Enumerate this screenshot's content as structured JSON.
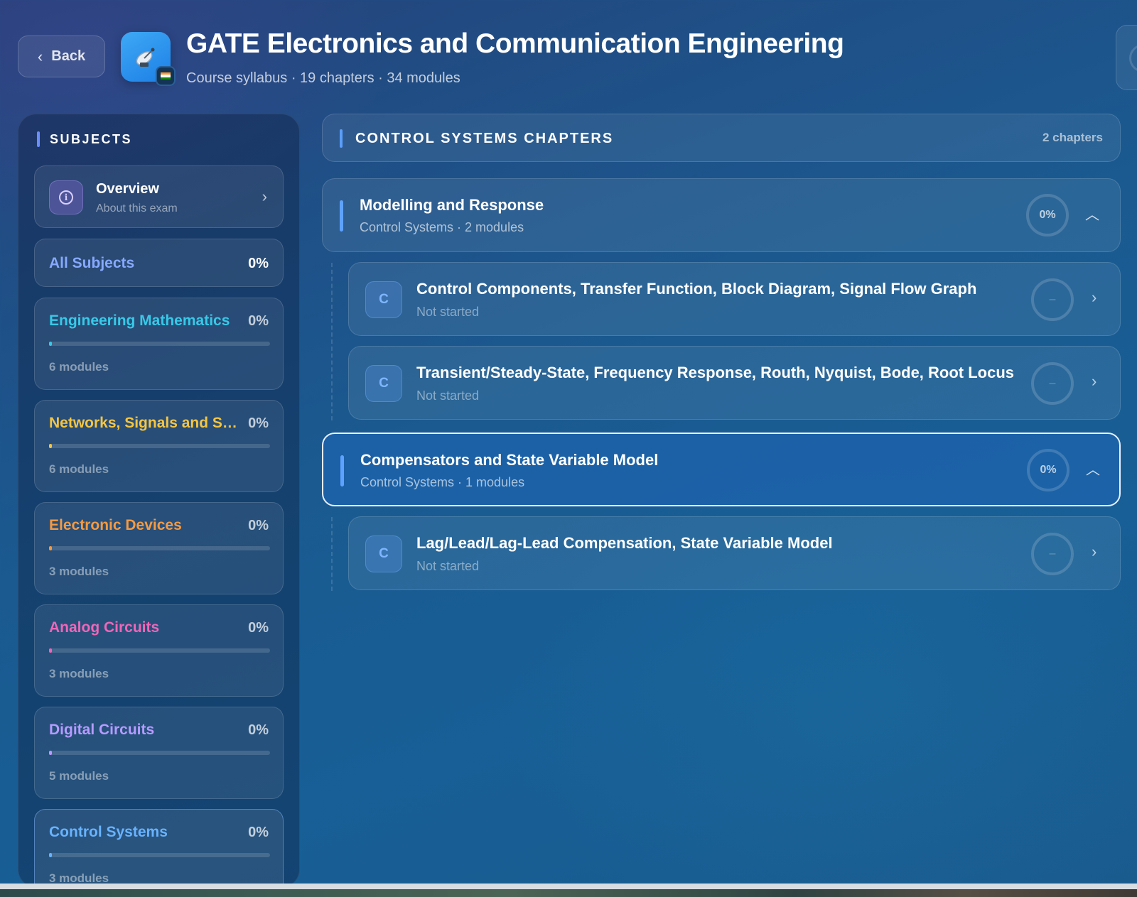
{
  "header": {
    "back_label": "Back",
    "title": "GATE Electronics and Communication Engineering",
    "subtitle": "Course syllabus · 19 chapters · 34 modules",
    "app_icon": "satellite-dish-icon",
    "flag_icon": "india-flag-icon"
  },
  "sidebar": {
    "heading": "SUBJECTS",
    "overview": {
      "title": "Overview",
      "subtitle": "About this exam",
      "icon": "info-icon"
    },
    "all_subjects": {
      "label": "All Subjects",
      "percent": "0%"
    },
    "subjects": [
      {
        "name": "Engineering Mathematics",
        "percent": "0%",
        "modules": "6 modules",
        "color": "#38c9e8",
        "progress": 0
      },
      {
        "name": "Networks, Signals and Systems",
        "percent": "0%",
        "modules": "6 modules",
        "color": "#f5c542",
        "progress": 0
      },
      {
        "name": "Electronic Devices",
        "percent": "0%",
        "modules": "3 modules",
        "color": "#f59a42",
        "progress": 0
      },
      {
        "name": "Analog Circuits",
        "percent": "0%",
        "modules": "3 modules",
        "color": "#f066b8",
        "progress": 0
      },
      {
        "name": "Digital Circuits",
        "percent": "0%",
        "modules": "5 modules",
        "color": "#b79bff",
        "progress": 0
      },
      {
        "name": "Control Systems",
        "percent": "0%",
        "modules": "3 modules",
        "color": "#68b3ff",
        "progress": 0
      }
    ]
  },
  "main": {
    "section_title": "CONTROL SYSTEMS CHAPTERS",
    "section_count": "2 chapters",
    "chapters": [
      {
        "title": "Modelling and Response",
        "subtitle": "Control Systems · 2 modules",
        "percent": "0%",
        "modules": [
          {
            "badge": "C",
            "title": "Control Components, Transfer Function, Block Diagram, Signal Flow Graph",
            "status": "Not started",
            "ring": "–"
          },
          {
            "badge": "C",
            "title": "Transient/Steady-State, Frequency Response, Routh, Nyquist, Bode, Root Locus",
            "status": "Not started",
            "ring": "–"
          }
        ]
      },
      {
        "title": "Compensators and State Variable Model",
        "subtitle": "Control Systems · 1 modules",
        "percent": "0%",
        "modules": [
          {
            "badge": "C",
            "title": "Lag/Lead/Lag-Lead Compensation, State Variable Model",
            "status": "Not started",
            "ring": "–"
          }
        ]
      }
    ]
  },
  "colors": {
    "accent": "#6d8dfa",
    "all_subjects_label": "#86a9ff",
    "active_border": "#e8f1ff"
  }
}
